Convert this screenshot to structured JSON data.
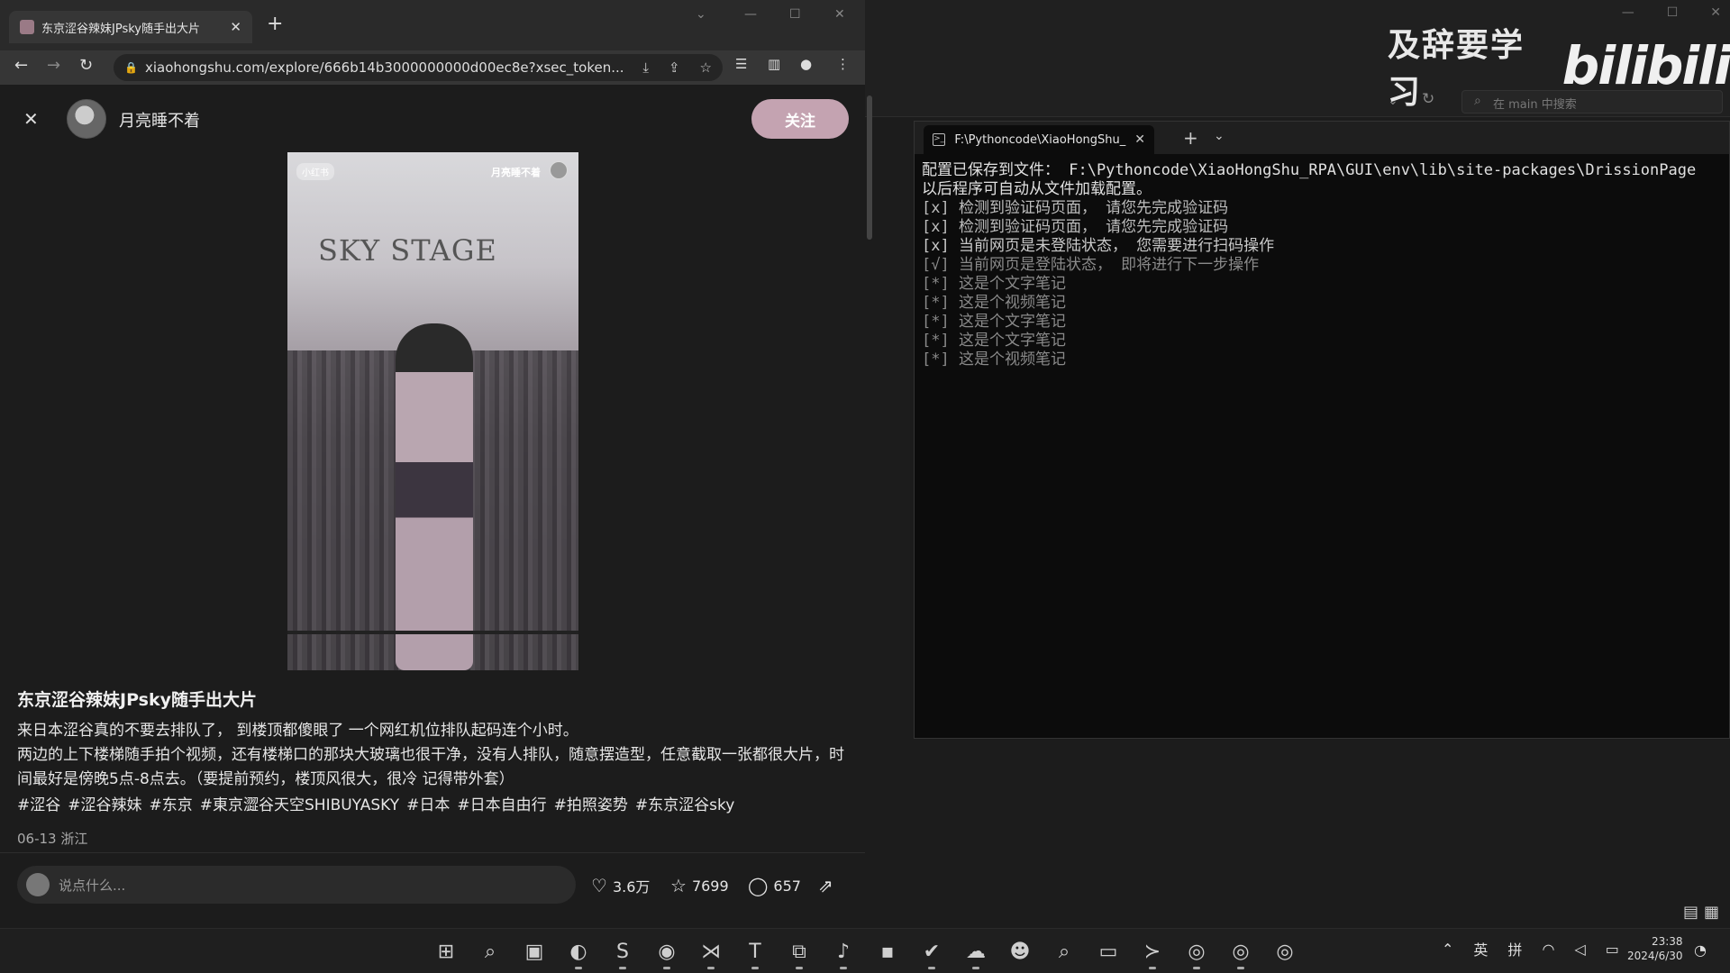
{
  "browser": {
    "tab_title": "东京涩谷辣妹JPsky随手出大片",
    "tab_close": "✕",
    "new_tab": "+",
    "url": "xiaohongshu.com/explore/666b14b3000000000d00ec8e?xsec_token...",
    "nav": {
      "back": "←",
      "forward": "→",
      "reload": "↻"
    }
  },
  "note": {
    "close": "✕",
    "author": "月亮睡不着",
    "follow_label": "关注",
    "image": {
      "top_left_tag": "小红书",
      "top_right_tag": "月亮睡不着",
      "overlay_text": "SKY STAGE"
    },
    "title": "东京涩谷辣妹JPsky随手出大片",
    "desc_lines": [
      "来日本涩谷真的不要去排队了，  到楼顶都傻眼了 一个网红机位排队起码连个小时。",
      "两边的上下楼梯随手拍个视频，还有楼梯口的那块大玻璃也很干净，没有人排队，随意摆造型，任意截取一张都很大片，时间最好是傍晚5点-8点去。（要提前预约，楼顶风很大，很冷 记得带外套）"
    ],
    "tags": [
      "#涩谷",
      "#涩谷辣妹",
      "#东京",
      "#東京澀谷天空SHIBUYASKY",
      "#日本",
      "#日本自由行",
      "#拍照姿势",
      "#东京涩谷sky"
    ],
    "date_location": "06-13 浙江",
    "comment_placeholder": "说点什么...",
    "likes": "3.6万",
    "collects": "7699",
    "comments": "657"
  },
  "background_window": {
    "search_placeholder": "在 main 中搜索"
  },
  "watermark": {
    "text": "及辞要学习",
    "logo": "bilibili"
  },
  "terminal": {
    "tab_title": "F:\\Pythoncode\\XiaoHongShu_",
    "lines": [
      "配置已保存到文件： F:\\Pythoncode\\XiaoHongShu_RPA\\GUI\\env\\lib\\site-packages\\DrissionPage",
      "以后程序可自动从文件加载配置。",
      "[x] 检测到验证码页面， 请您先完成验证码",
      "[x] 检测到验证码页面， 请您先完成验证码",
      "[x] 当前网页是未登陆状态， 您需要进行扫码操作",
      "[√] 当前网页是登陆状态， 即将进行下一步操作",
      "[*] 这是个文字笔记",
      "[*] 这是个视频笔记",
      "[*] 这是个文字笔记",
      "[*] 这是个文字笔记",
      "[*] 这是个视频笔记"
    ],
    "line_colors": [
      "#e0e0e0",
      "#e0e0e0",
      "#bdbdbd",
      "#bdbdbd",
      "#c9c9c9",
      "#8a8a8a",
      "#8a8a8a",
      "#8a8a8a",
      "#8a8a8a",
      "#8a8a8a",
      "#8a8a8a"
    ]
  },
  "taskbar": {
    "icons": [
      "windows-start-icon",
      "search-icon",
      "task-view-icon",
      "edge-icon",
      "sublime-icon",
      "obs-icon",
      "vscode-icon",
      "typora-icon",
      "multiwindow-icon",
      "music-icon",
      "photo-icon",
      "check-icon",
      "wechat-icon",
      "qq-icon",
      "everything-icon",
      "explorer-icon",
      "terminal-icon",
      "chrome-icon-1",
      "chrome-icon-2",
      "chrome-icon-3"
    ],
    "ime_lang": "英",
    "ime_mode": "拼",
    "time": "23:38",
    "date": "2024/6/30"
  }
}
